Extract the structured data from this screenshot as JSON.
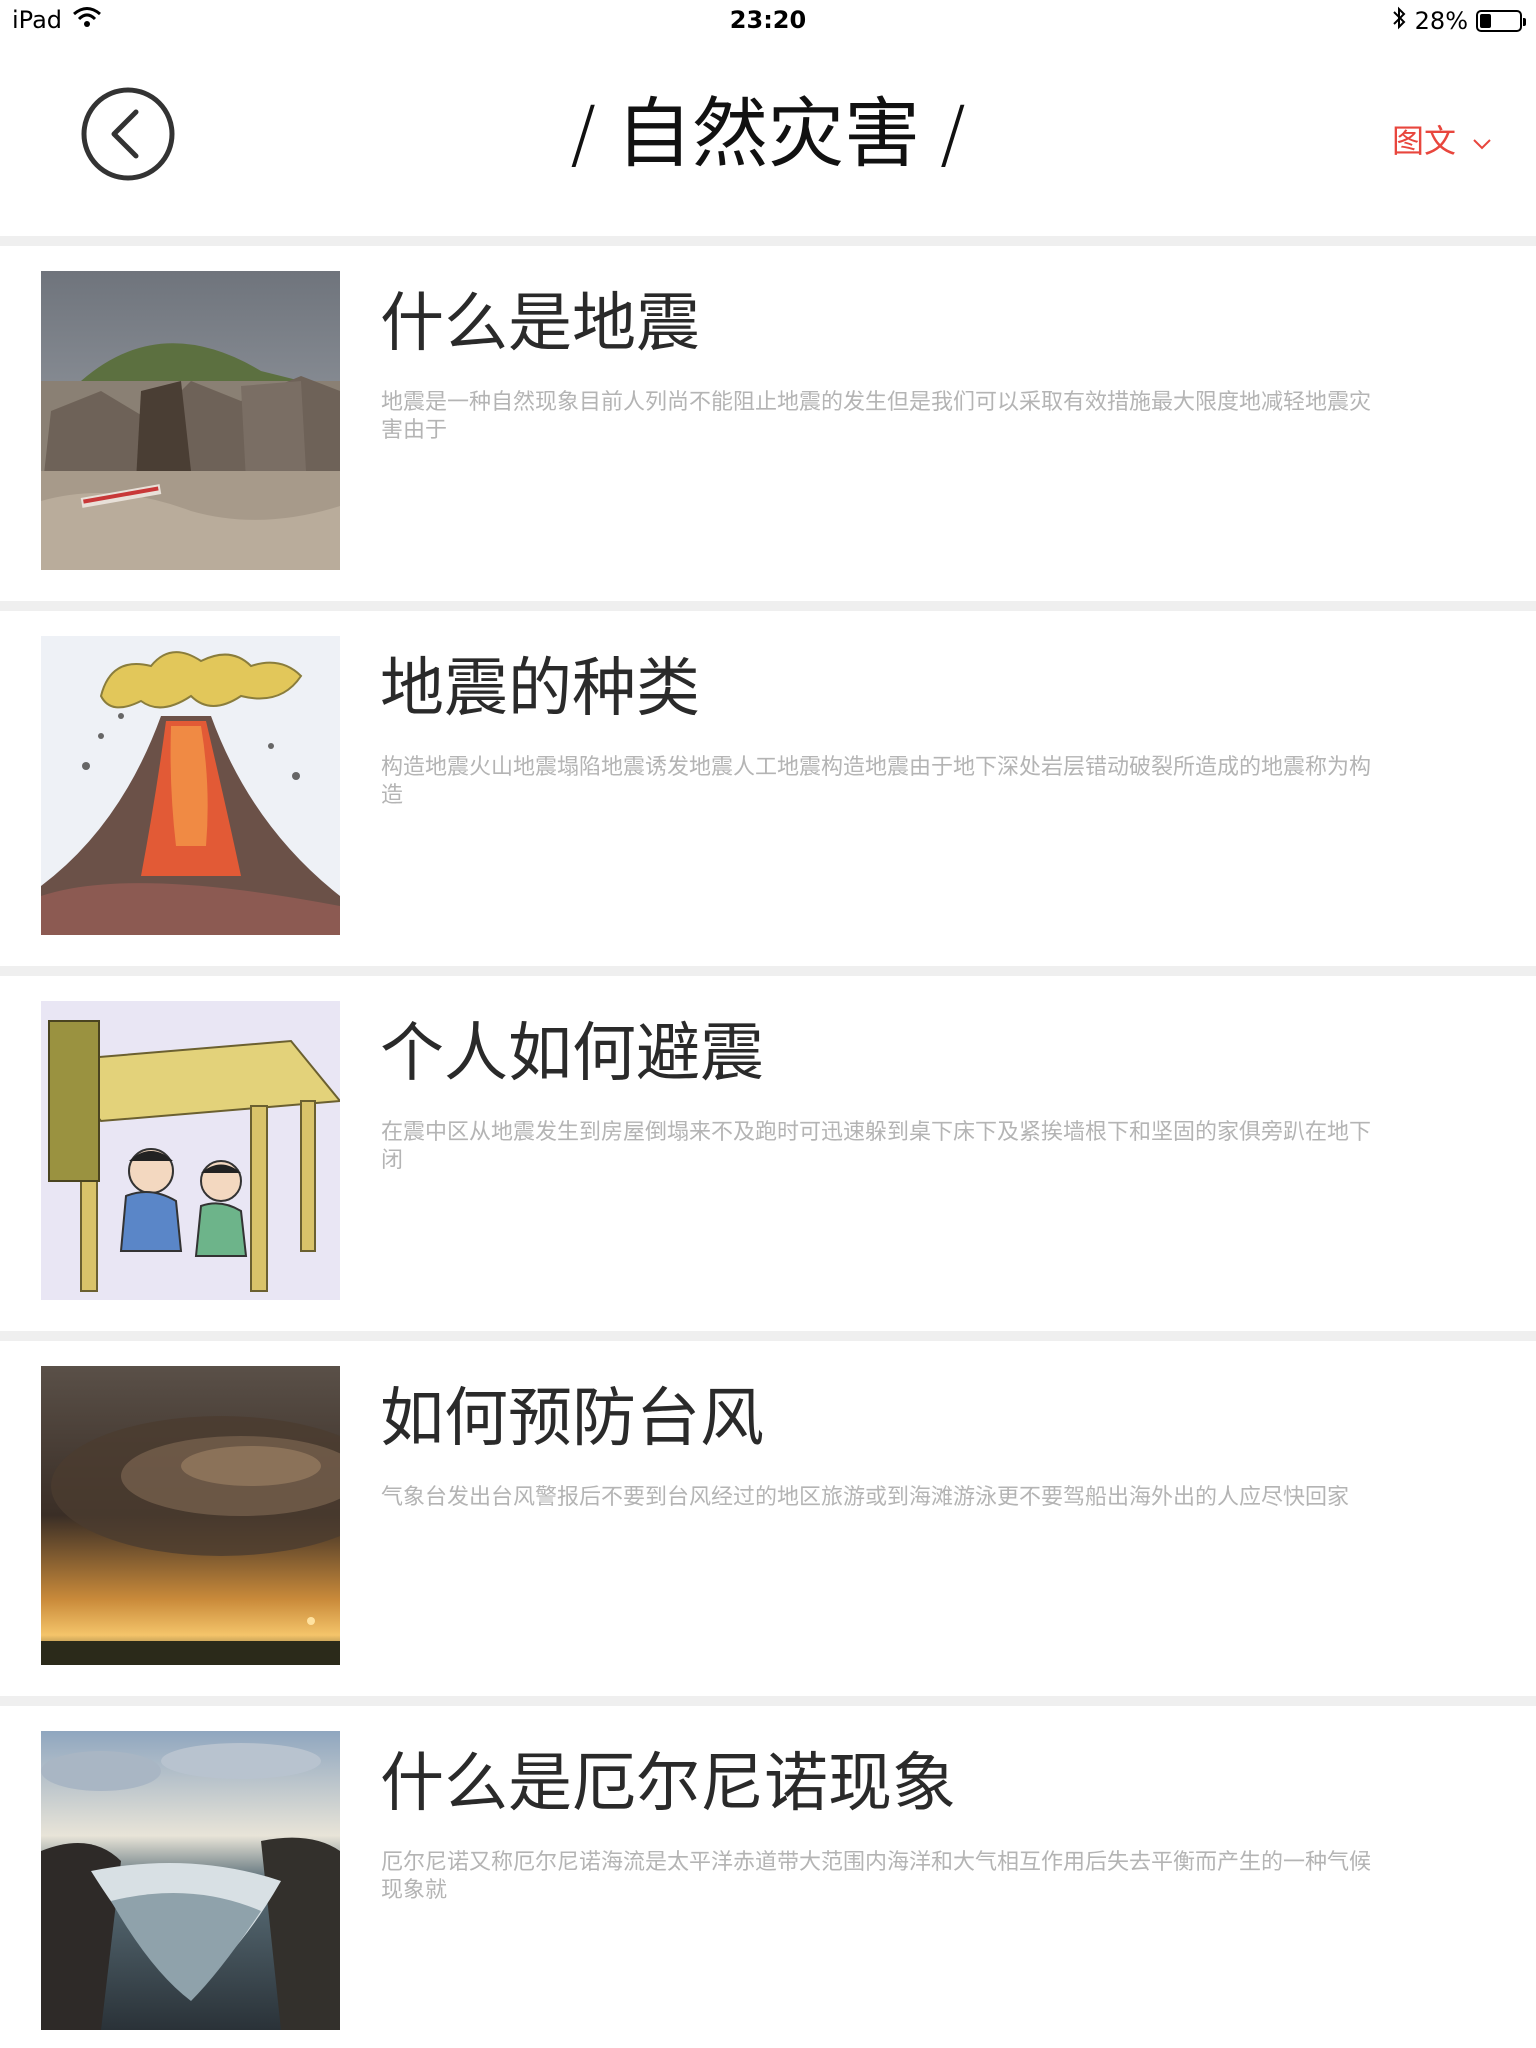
{
  "status_bar": {
    "device": "iPad",
    "time": "23:20",
    "battery_text": "28%",
    "battery_level": 0.28,
    "icons": [
      "wifi-icon",
      "bluetooth-icon",
      "battery-icon"
    ]
  },
  "nav": {
    "back_icon": "chevron-left-circle-icon",
    "title_prefix": "/",
    "title": "自然灾害",
    "title_suffix": "/",
    "mode_label": "图文",
    "mode_icon": "chevron-down-icon",
    "accent_color": "#e8463d"
  },
  "items": [
    {
      "title": "什么是地震",
      "desc": "地震是一种自然现象目前人列尚不能阻止地震的发生但是我们可以采取有效措施最大限度地减轻地震灾害由于",
      "image": "earthquake-ruins-photo"
    },
    {
      "title": "地震的种类",
      "desc": "构造地震火山地震塌陷地震诱发地震人工地震构造地震由于地下深处岩层错动破裂所造成的地震称为构造",
      "image": "volcano-illustration"
    },
    {
      "title": "个人如何避震",
      "desc": "在震中区从地震发生到房屋倒塌来不及跑时可迅速躲到桌下床下及紧挨墙根下和坚固的家俱旁趴在地下闭",
      "image": "kids-under-table-illustration"
    },
    {
      "title": "如何预防台风",
      "desc": "气象台发出台风警报后不要到台风经过的地区旅游或到海滩游泳更不要驾船出海外出的人应尽快回家",
      "image": "storm-cloud-photo"
    },
    {
      "title": "什么是厄尔尼诺现象",
      "desc": "厄尔尼诺又称厄尔尼诺海流是太平洋赤道带大范围内海洋和大气相互作用后失去平衡而产生的一种气候现象就",
      "image": "rough-sea-photo"
    }
  ]
}
